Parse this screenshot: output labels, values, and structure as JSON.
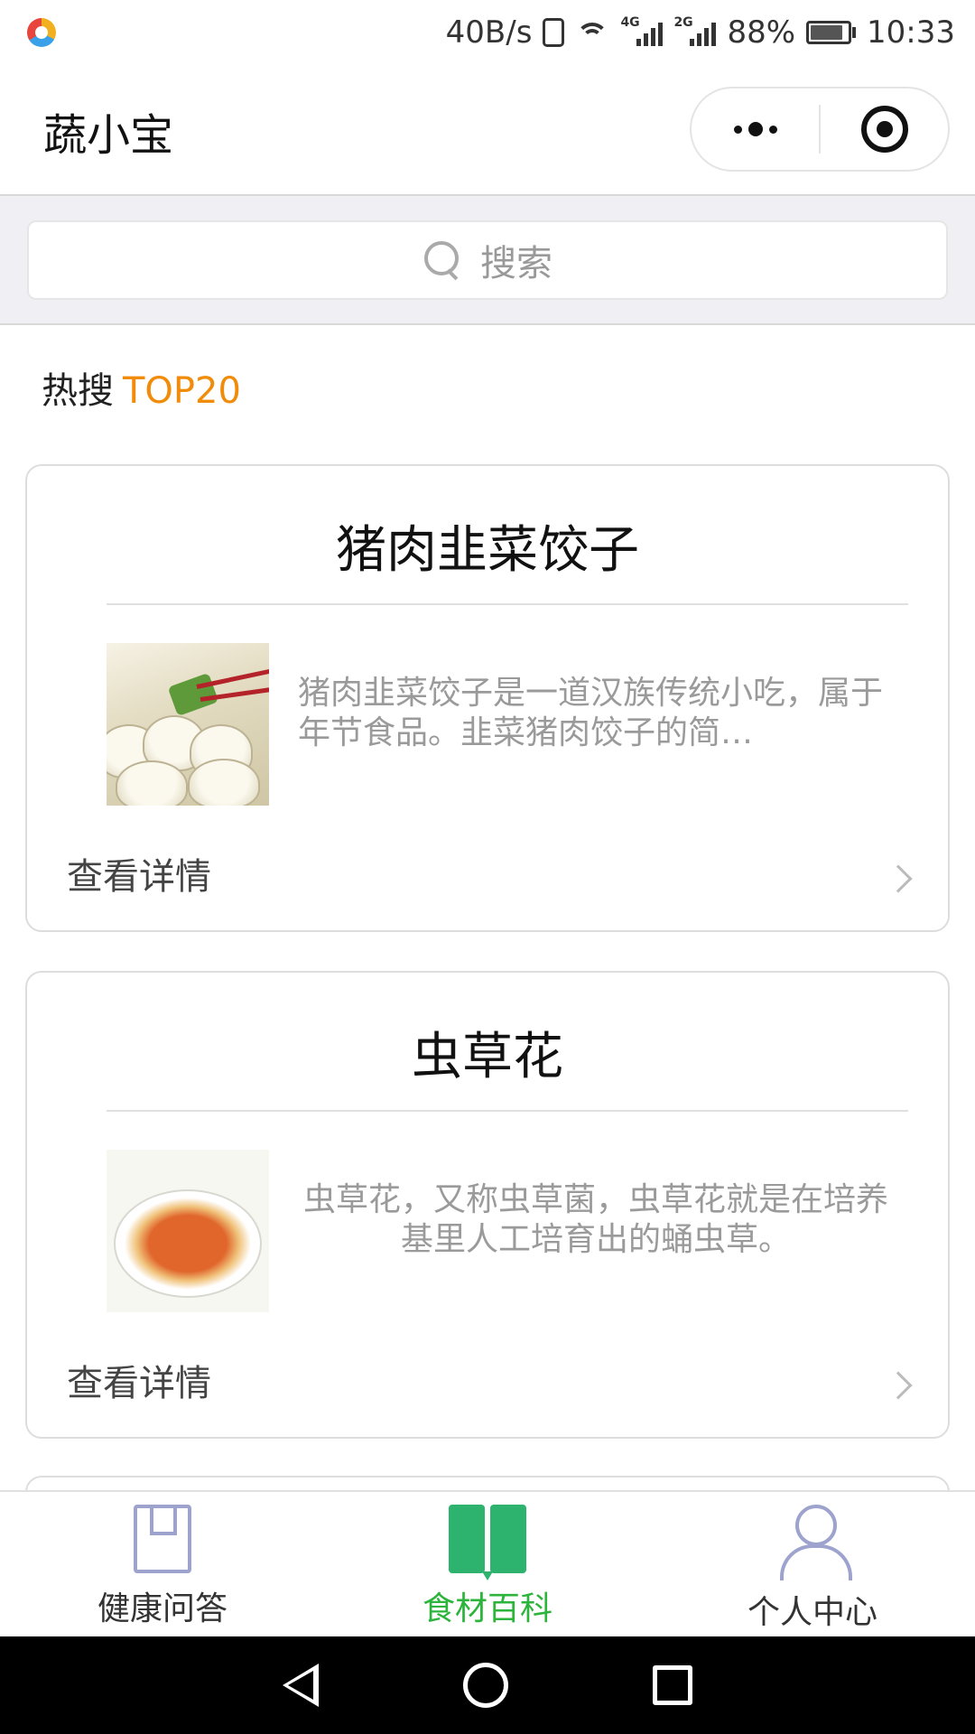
{
  "status_bar": {
    "speed": "40B/s",
    "net1": "4G",
    "net2": "2G",
    "battery_text": "88%",
    "battery_level": 0.88,
    "time": "10:33"
  },
  "nav": {
    "title": "蔬小宝",
    "more_icon": "more-dots-icon",
    "close_icon": "target-circle-icon"
  },
  "search": {
    "placeholder": "搜索",
    "icon": "search-icon"
  },
  "hot": {
    "label": "热搜",
    "accent": "TOP20",
    "accent_color": "#f08c0a"
  },
  "cards": [
    {
      "title": "猪肉韭菜饺子",
      "description": "猪肉韭菜饺子是一道汉族传统小吃，属于年节食品。韭菜猪肉饺子的简…",
      "link_label": "查看详情",
      "image": "dumplings-photo"
    },
    {
      "title": "虫草花",
      "description": "虫草花，又称虫草菌，虫草花就是在培养基里人工培育出的蛹虫草。",
      "link_label": "查看详情",
      "image": "cordyceps-salad-photo"
    }
  ],
  "tabs": [
    {
      "label": "健康问答",
      "icon": "book-outline-icon",
      "active": false
    },
    {
      "label": "食材百科",
      "icon": "open-book-icon",
      "active": true
    },
    {
      "label": "个人中心",
      "icon": "person-icon",
      "active": false
    }
  ],
  "colors": {
    "active_tab": "#2db43c",
    "accent": "#f08c0a"
  }
}
